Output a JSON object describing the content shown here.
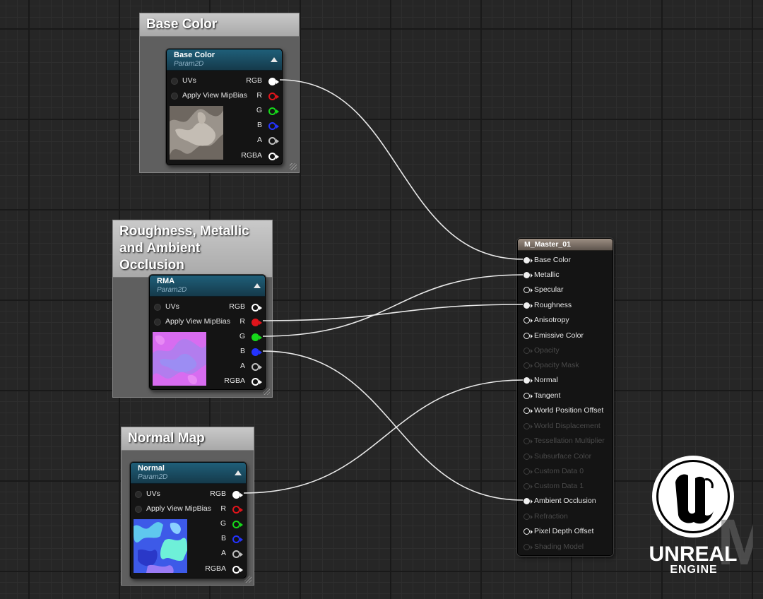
{
  "comments": {
    "base_color": "Base Color",
    "rma": "Roughness, Metallic\nand Ambient Occlusion",
    "normal_map": "Normal Map"
  },
  "nodes": {
    "base_color": {
      "title": "Base Color",
      "subtitle": "Param2D"
    },
    "rma": {
      "title": "RMA",
      "subtitle": "Param2D"
    },
    "normal": {
      "title": "Normal",
      "subtitle": "Param2D"
    }
  },
  "texture_inputs": [
    "UVs",
    "Apply View MipBias"
  ],
  "texture_outputs": [
    "RGB",
    "R",
    "G",
    "B",
    "A",
    "RGBA"
  ],
  "channel_colors": {
    "RGB": "#ffffff",
    "R": "#e0141b",
    "G": "#16d81a",
    "B": "#2433ff",
    "A": "#bfbfbf",
    "RGBA": "#ffffff"
  },
  "master": {
    "title": "M_Master_01",
    "inputs": [
      "Base Color",
      "Metallic",
      "Specular",
      "Roughness",
      "Anisotropy",
      "Emissive Color",
      "Opacity",
      "Opacity Mask",
      "Normal",
      "Tangent",
      "World Position Offset",
      "World Displacement",
      "Tessellation Multiplier",
      "Subsurface Color",
      "Custom Data 0",
      "Custom Data 1",
      "Ambient Occlusion",
      "Refraction",
      "Pixel Depth Offset",
      "Shading Model"
    ]
  },
  "logo": {
    "line1": "UNREAL",
    "line2": "ENGINE",
    "watermark": "MA"
  }
}
